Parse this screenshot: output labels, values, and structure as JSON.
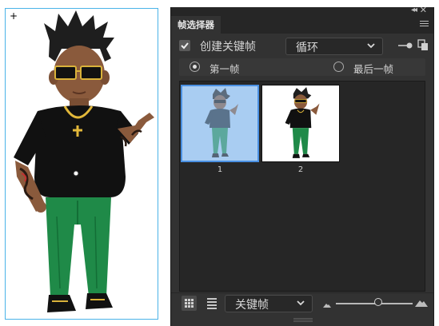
{
  "panel": {
    "tab_title": "帧选择器",
    "create_keyframe": {
      "label": "创建关键帧",
      "checked": true
    },
    "loop_dropdown": {
      "value": "循环"
    },
    "radio_options": [
      {
        "label": "第一帧",
        "selected": true
      },
      {
        "label": "最后一帧",
        "selected": false
      }
    ],
    "frames": [
      {
        "number": "1",
        "selected": true
      },
      {
        "number": "2",
        "selected": false
      }
    ],
    "filter_dropdown": {
      "value": "关键帧"
    },
    "thumbnail_size": 0.55
  },
  "colors": {
    "panel_bg": "#323232",
    "selection_blue": "#4a90e2",
    "canvas_border": "#4ab3e8"
  },
  "icons": [
    "collapse-icon",
    "close-icon",
    "panel-menu-icon",
    "checkmark-icon",
    "chevron-down-icon",
    "link-icon",
    "copy-icon",
    "grid-view-icon",
    "list-view-icon",
    "small-mountain-icon",
    "large-mountain-icon"
  ]
}
